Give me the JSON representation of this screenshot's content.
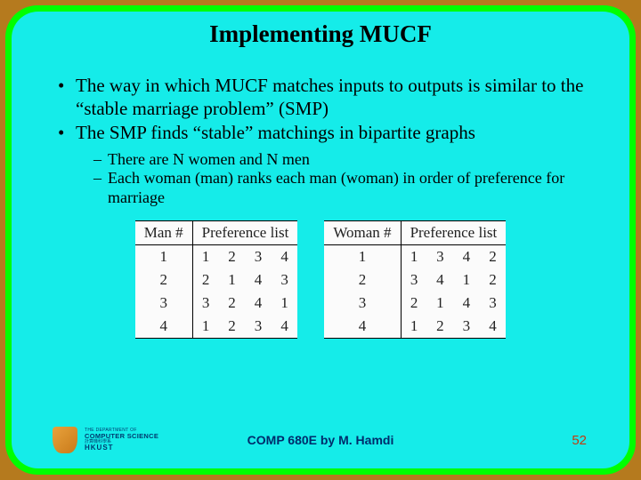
{
  "title": "Implementing MUCF",
  "bullets": {
    "b1": "The way in which MUCF matches inputs to outputs is similar to the “stable marriage problem” (SMP)",
    "b2": "The SMP finds “stable” matchings in bipartite graphs"
  },
  "sub": {
    "s1": "There are N women and N men",
    "s2": "Each woman (man) ranks each man (woman) in order of preference for marriage"
  },
  "tables": {
    "left": {
      "h1": "Man #",
      "h2": "Preference list",
      "rows": [
        {
          "i": "1",
          "a": "1",
          "b": "2",
          "c": "3",
          "d": "4"
        },
        {
          "i": "2",
          "a": "2",
          "b": "1",
          "c": "4",
          "d": "3"
        },
        {
          "i": "3",
          "a": "3",
          "b": "2",
          "c": "4",
          "d": "1"
        },
        {
          "i": "4",
          "a": "1",
          "b": "2",
          "c": "3",
          "d": "4"
        }
      ]
    },
    "right": {
      "h1": "Woman #",
      "h2": "Preference list",
      "rows": [
        {
          "i": "1",
          "a": "1",
          "b": "3",
          "c": "4",
          "d": "2"
        },
        {
          "i": "2",
          "a": "3",
          "b": "4",
          "c": "1",
          "d": "2"
        },
        {
          "i": "3",
          "a": "2",
          "b": "1",
          "c": "4",
          "d": "3"
        },
        {
          "i": "4",
          "a": "1",
          "b": "2",
          "c": "3",
          "d": "4"
        }
      ]
    }
  },
  "logo": {
    "l1": "THE DEPARTMENT OF",
    "l2": "COMPUTER SCIENCE",
    "l3": "計算機科學系",
    "l4": "HKUST"
  },
  "footer": {
    "course": "COMP 680E by M. Hamdi",
    "page": "52"
  }
}
